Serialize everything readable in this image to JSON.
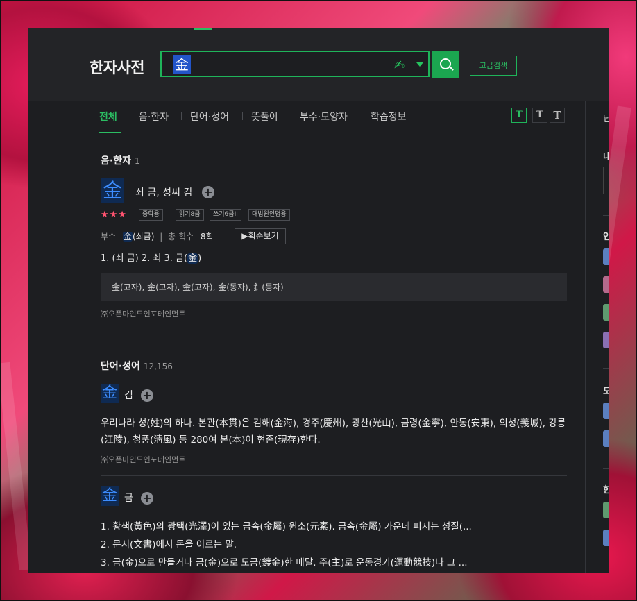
{
  "header": {
    "title": "한자사전",
    "search_value": "金",
    "advanced_search_label": "고급검색"
  },
  "tabs": [
    "전체",
    "음·한자",
    "단어·성어",
    "뜻풀이",
    "부수·모양자",
    "학습정보"
  ],
  "font_size_buttons": [
    "T",
    "T",
    "T"
  ],
  "sidebar": {
    "partial_labels": [
      "단",
      "내",
      "인",
      "도",
      "한"
    ]
  },
  "sound_hanja": {
    "heading": "음·한자",
    "count": "1",
    "char": "金",
    "meaning": "쇠 금, 성씨 김",
    "stars": "★★★",
    "tags": [
      "중학용",
      "읽기8급",
      "쓰기6급II",
      "대법원인명용"
    ],
    "radical_label": "부수",
    "radical_char": "金",
    "radical_name": "(쇠금)",
    "stroke_label": "총 획수",
    "stroke_count": "8획",
    "stroke_btn": "획순보기",
    "definitions_pre": "1. (쇠 금)  2. 쇠  3. 금(",
    "definitions_char": "金",
    "definitions_post": ")",
    "variants": "金(고자), 金(고자), 金(고자), 金(동자), 釒(동자)",
    "source": "㈜오픈마인드인포테인먼트"
  },
  "words": {
    "heading": "단어·성어",
    "count": "12,156",
    "entries": [
      {
        "char": "金",
        "reading": "김",
        "text": "우리나라 성(姓)의 하나. 본관(本貫)은 김해(金海), 경주(慶州), 광산(光山), 금령(金寧), 안동(安東), 의성(義城), 강릉(江陵), 청풍(淸風) 등 280여 본(本)이 현존(現存)한다.",
        "source": "㈜오픈마인드인포테인먼트"
      },
      {
        "char": "金",
        "reading": "금",
        "lines": [
          "1. 황색(黃色)의 광택(光澤)이 있는 금속(金屬) 원소(元素). 금속(金屬) 가운데 퍼지는 성질(...",
          "2. 문서(文書)에서 돈을 이르는 말.",
          "3. 금(金)으로 만들거나 금(金)으로 도금(鍍金)한 메달. 주(主)로 운동경기(運動競技)나 그 ..."
        ]
      }
    ]
  },
  "colors": {
    "accent": "#2bbd62",
    "highlight_bg": "#0f2a52",
    "hanja_blue": "#3d8dff"
  }
}
